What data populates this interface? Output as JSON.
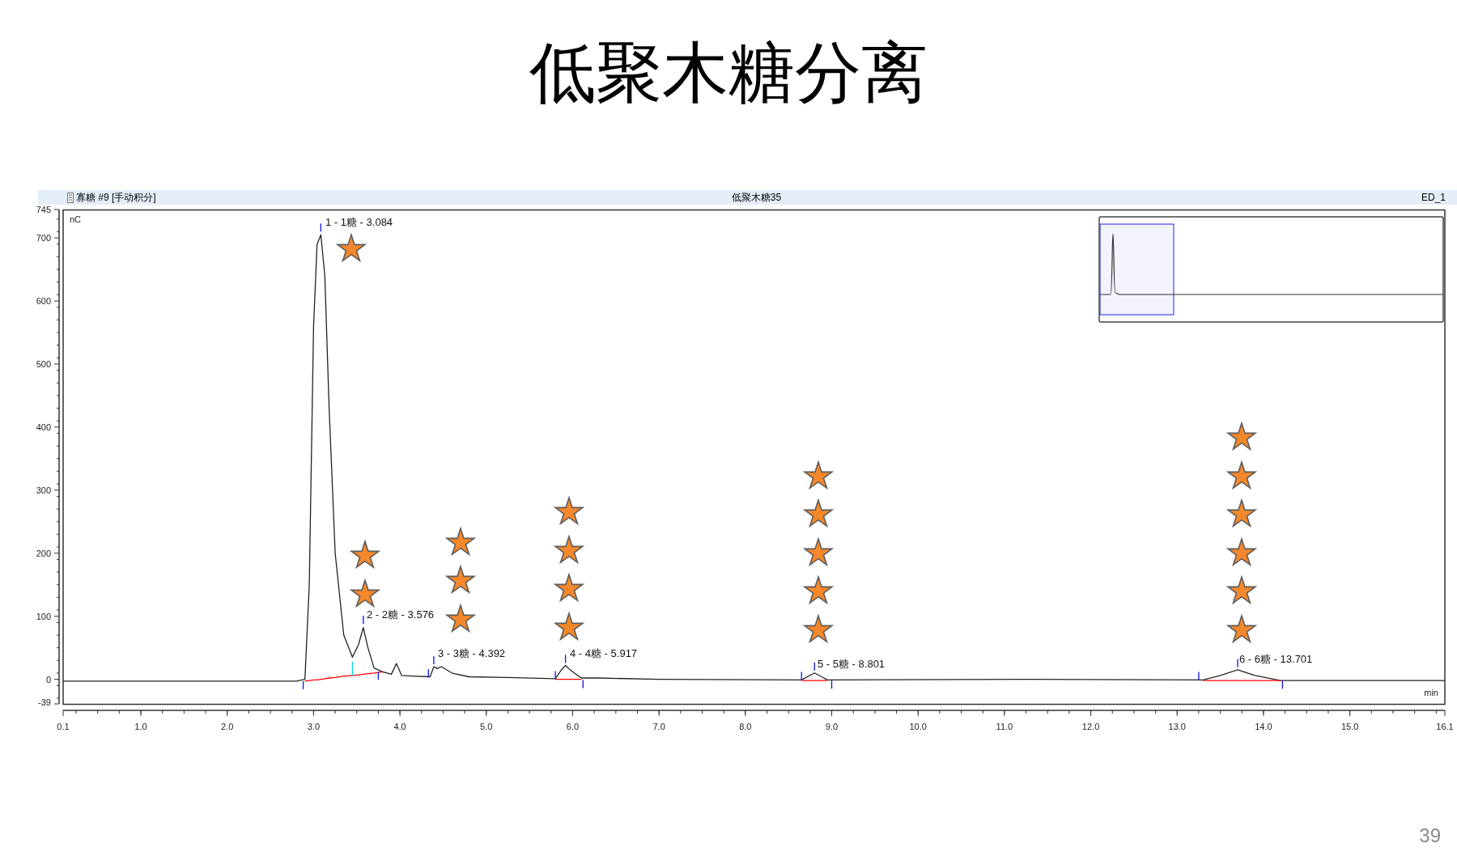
{
  "slide": {
    "title": "低聚木糖分离",
    "page_number": "39"
  },
  "chromatogram": {
    "sample": "寡糖 #9 [手动积分]",
    "title": "低聚木糖35",
    "chart_data": {
      "type": "line",
      "xlabel": "min",
      "ylabel": "nC",
      "xlim": [
        0.1,
        16.1
      ],
      "ylim": [
        -39,
        745
      ],
      "xticks": [
        {
          "value": 0.1,
          "label": "0.1"
        },
        {
          "value": 1,
          "label": "1.0"
        },
        {
          "value": 2,
          "label": "2.0"
        },
        {
          "value": 3,
          "label": "3.0"
        },
        {
          "value": 4,
          "label": "4.0"
        },
        {
          "value": 5,
          "label": "5.0"
        },
        {
          "value": 6,
          "label": "6.0"
        },
        {
          "value": 7,
          "label": "7.0"
        },
        {
          "value": 8,
          "label": "8.0"
        },
        {
          "value": 9,
          "label": "9.0"
        },
        {
          "value": 10,
          "label": "10.0"
        },
        {
          "value": 11,
          "label": "11.0"
        },
        {
          "value": 12,
          "label": "12.0"
        },
        {
          "value": 13,
          "label": "13.0"
        },
        {
          "value": 14,
          "label": "14.0"
        },
        {
          "value": 15,
          "label": "15.0"
        },
        {
          "value": 16.1,
          "label": "16.1"
        }
      ],
      "yticks": [
        745,
        700,
        600,
        500,
        400,
        300,
        200,
        100,
        0,
        -39
      ],
      "x": [
        0.1,
        2.8,
        2.9,
        2.95,
        3.0,
        3.04,
        3.084,
        3.13,
        3.18,
        3.25,
        3.35,
        3.45,
        3.52,
        3.576,
        3.63,
        3.7,
        3.8,
        3.9,
        3.96,
        4.02,
        4.15,
        4.35,
        4.392,
        4.43,
        4.48,
        4.6,
        4.8,
        5.25,
        5.8,
        5.87,
        5.917,
        5.97,
        6.1,
        6.3,
        7.0,
        8.65,
        8.801,
        8.95,
        11.25,
        13.3,
        13.5,
        13.701,
        13.9,
        14.2,
        16.1
      ],
      "series": [
        {
          "name": "ED_1",
          "color": "#222222",
          "values": [
            -3,
            -3,
            0,
            150,
            560,
            690,
            705,
            640,
            430,
            200,
            70,
            35,
            55,
            82,
            50,
            18,
            12,
            8,
            25,
            6,
            5,
            4,
            20,
            17,
            20,
            10,
            4,
            3,
            1,
            15,
            22,
            15,
            2,
            2,
            0,
            -1,
            10,
            -1,
            0,
            -1,
            6,
            15,
            6,
            -2,
            -2
          ]
        },
        {
          "color": "#ff0000",
          "values": [
            null,
            null,
            -3,
            -2,
            -1,
            -1,
            0,
            1,
            2,
            3,
            5,
            6,
            7,
            8,
            9,
            10,
            12,
            null,
            null,
            null,
            null,
            null,
            null,
            null,
            null,
            null,
            null,
            null,
            0,
            0,
            0,
            0,
            0,
            null,
            null,
            -2,
            -2,
            -2,
            null,
            -2,
            -2,
            -2,
            -2,
            -2,
            null
          ]
        }
      ]
    },
    "peaks": [
      {
        "label": "1 - 1糖 - 3.084",
        "marks": "★"
      },
      {
        "label": "2 - 2糖 - 3.576",
        "marks": "★★"
      },
      {
        "label": "3 - 3糖 - 4.392",
        "marks": "★★★"
      },
      {
        "label": "4 - 4糖 - 5.917",
        "marks": "★★★★"
      },
      {
        "label": "5 - 5糖 - 8.801",
        "marks": "★★★★★"
      },
      {
        "label": "6 - 6糖 - 13.701",
        "marks": "★★★★★★"
      }
    ]
  }
}
